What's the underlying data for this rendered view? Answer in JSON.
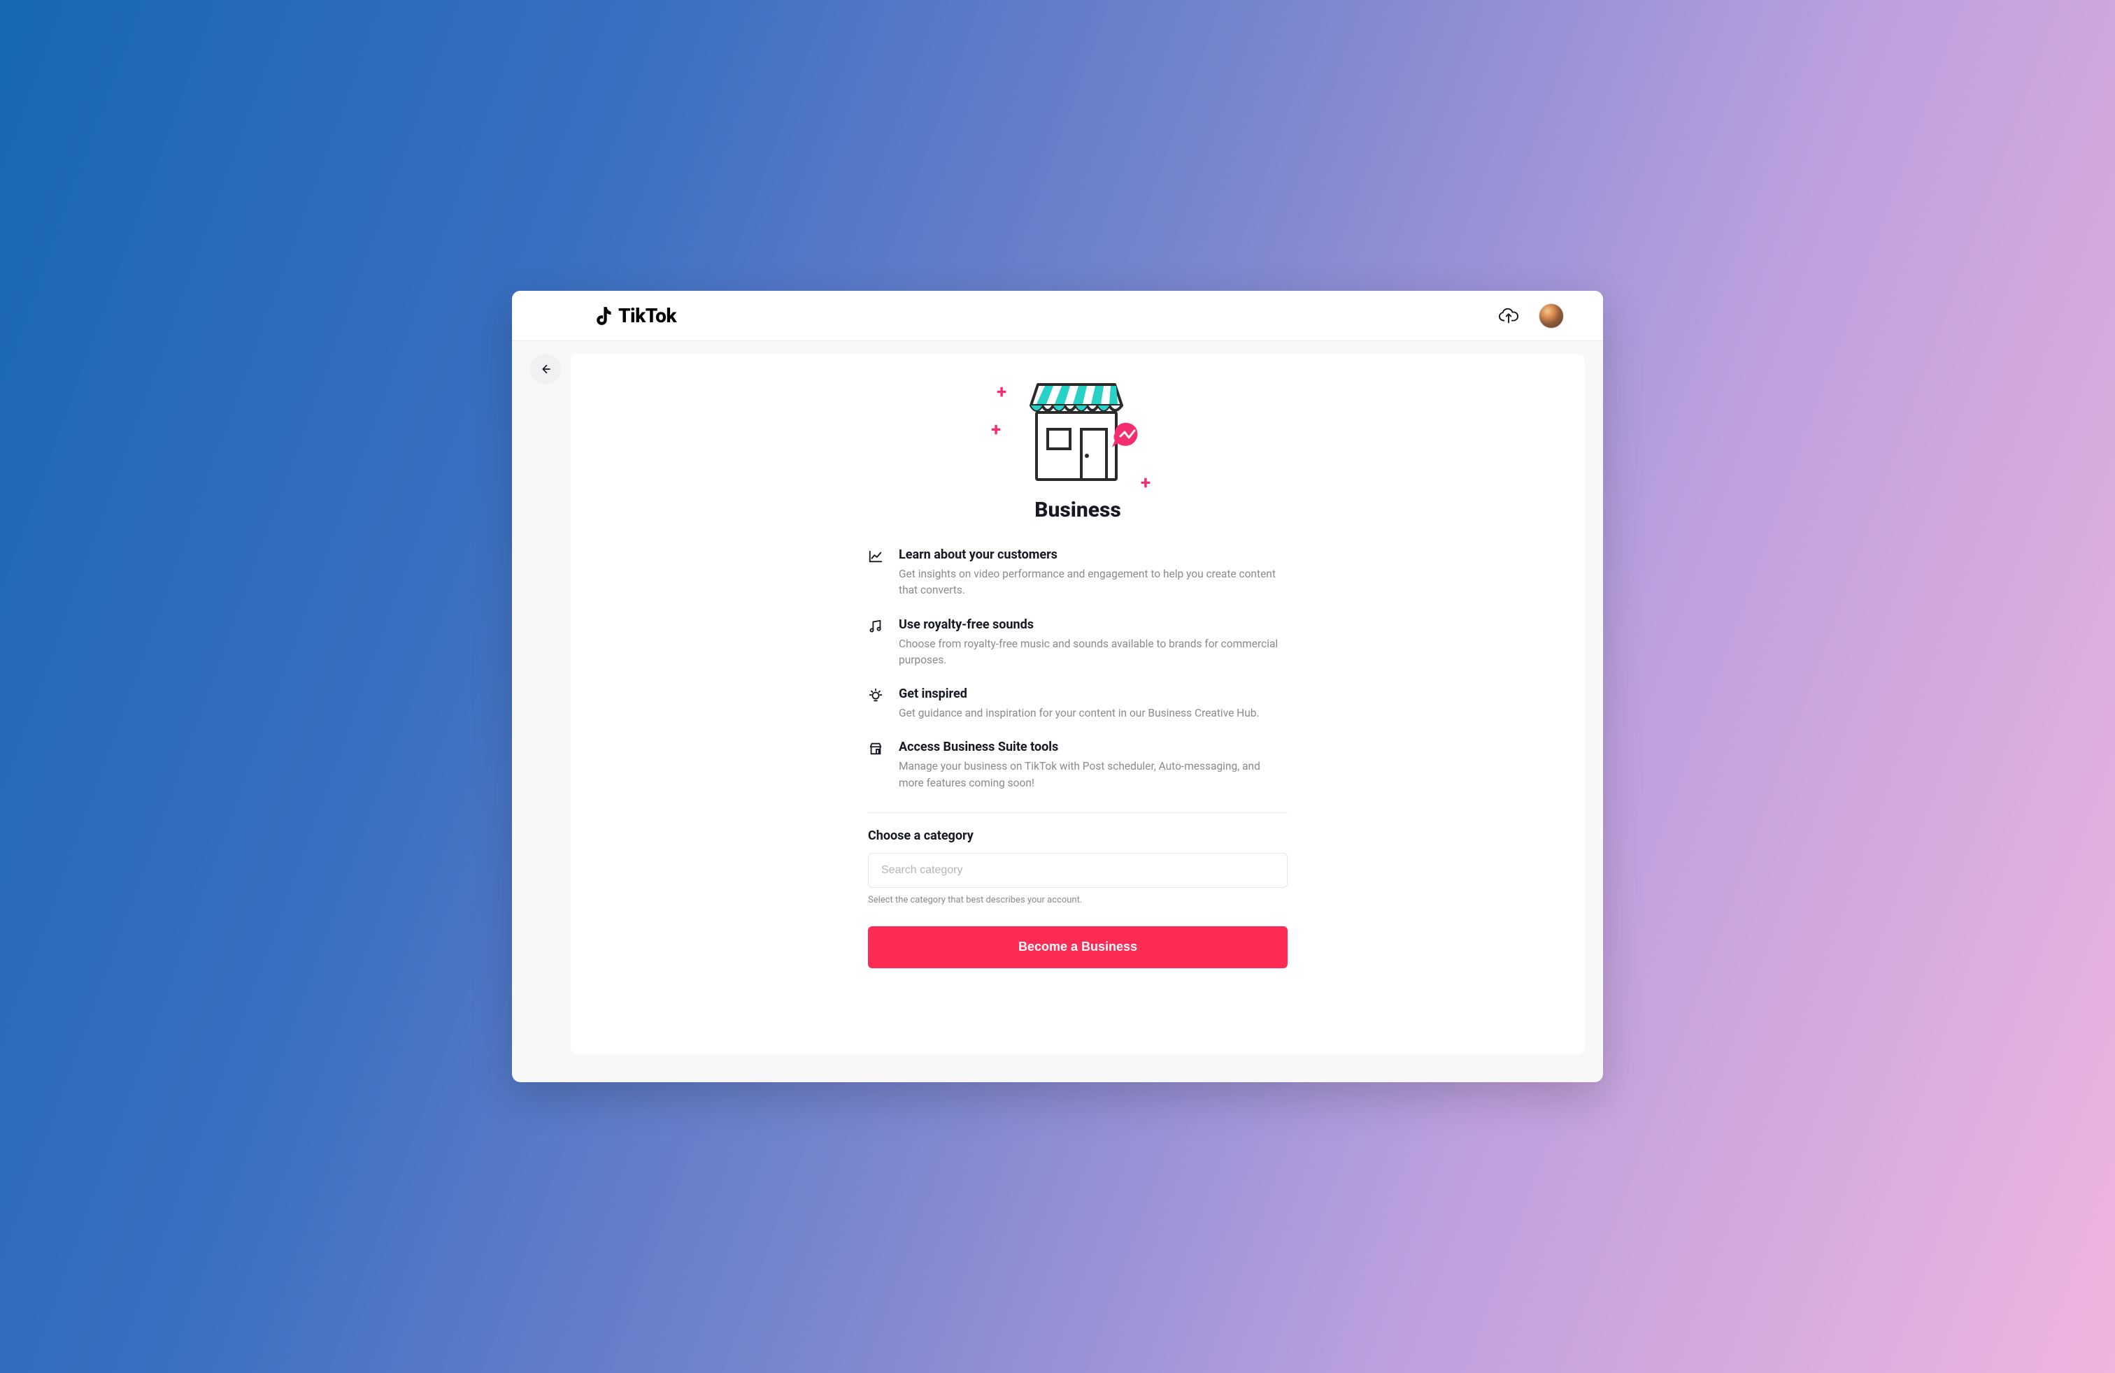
{
  "brand": "TikTok",
  "page_title": "Business",
  "features": [
    {
      "title": "Learn about your customers",
      "desc": "Get insights on video performance and engagement to help you create content that converts."
    },
    {
      "title": "Use royalty-free sounds",
      "desc": "Choose from royalty-free music and sounds available to brands for commercial purposes."
    },
    {
      "title": "Get inspired",
      "desc": "Get guidance and inspiration for your content in our Business Creative Hub."
    },
    {
      "title": "Access Business Suite tools",
      "desc": "Manage your business on TikTok with Post scheduler, Auto-messaging, and more features coming soon!"
    }
  ],
  "category": {
    "label": "Choose a category",
    "placeholder": "Search category",
    "helper": "Select the category that best describes your account."
  },
  "cta_label": "Become a Business"
}
